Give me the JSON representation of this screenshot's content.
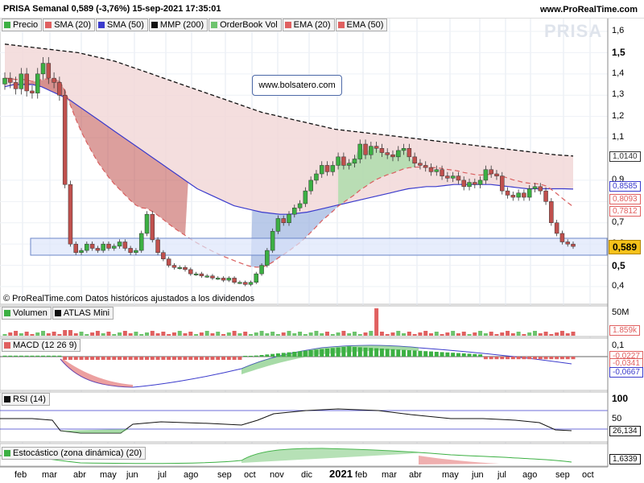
{
  "header": {
    "title": "PRISA Semanal 0,589 (-3,76%) 15-sep-2021 17:35:01",
    "site": "www.ProRealTime.com",
    "watermark": "PRISA"
  },
  "legend": [
    {
      "label": "Precio",
      "color": "#3cb043"
    },
    {
      "label": "SMA (20)",
      "color": "#e06060"
    },
    {
      "label": "SMA (50)",
      "color": "#3b3bcc"
    },
    {
      "label": "MMP (200)",
      "color": "#111111"
    },
    {
      "label": "OrderBook Vol",
      "color": "#6dc36d"
    },
    {
      "label": "EMA (20)",
      "color": "#e06060"
    },
    {
      "label": "EMA (50)",
      "color": "#e06060"
    }
  ],
  "annotation": "www.bolsatero.com",
  "footnote": "© ProRealTime.com  Datos históricos ajustados a los dividendos",
  "price_axis": {
    "ticks": [
      "1,6",
      "1,5",
      "1,4",
      "1,3",
      "1,2",
      "1,1",
      "0,9",
      "0,8",
      "0,7",
      "0,6",
      "0,5",
      "0,4"
    ],
    "tags": [
      {
        "text": "1,0140",
        "color": "#333333"
      },
      {
        "text": "0,8585",
        "color": "#3b3bcc"
      },
      {
        "text": "0,8093",
        "color": "#e06060"
      },
      {
        "text": "0,7812",
        "color": "#e06060"
      }
    ],
    "last": "0,589"
  },
  "panels": {
    "volume": {
      "labels": [
        "Volumen",
        "ATLAS Mini"
      ],
      "axis": "50M",
      "tag": "1.859k"
    },
    "macd": {
      "label": "MACD (12 26 9)",
      "axis": "0,1",
      "tags": [
        "-0,0227",
        "-0,0341",
        "-0,0667"
      ]
    },
    "rsi": {
      "label": "RSI (14)",
      "axis_top": "100",
      "axis_mid": "50",
      "tag": "26,134"
    },
    "stoch": {
      "label": "Estocástico (zona dinámica) (20)",
      "tag": "1,6339"
    }
  },
  "months": [
    "feb",
    "mar",
    "abr",
    "may",
    "jun",
    "jul",
    "ago",
    "sep",
    "oct",
    "nov",
    "dic",
    "2021",
    "feb",
    "mar",
    "abr",
    "may",
    "jun",
    "jul",
    "ago",
    "sep",
    "oct"
  ],
  "chart_data": {
    "type": "candlestick",
    "title": "PRISA Semanal 0,589 (-3,76%) 15-sep-2021 17:35:01",
    "ylim": [
      0.35,
      1.65
    ],
    "last_close": 0.589,
    "band": [
      0.54,
      0.63
    ],
    "weekly_close": [
      1.38,
      1.36,
      1.33,
      1.4,
      1.32,
      1.31,
      1.4,
      1.45,
      1.38,
      1.36,
      1.3,
      0.88,
      0.6,
      0.56,
      0.57,
      0.6,
      0.58,
      0.57,
      0.6,
      0.58,
      0.59,
      0.61,
      0.58,
      0.56,
      0.57,
      0.65,
      0.74,
      0.62,
      0.56,
      0.53,
      0.5,
      0.49,
      0.49,
      0.48,
      0.46,
      0.46,
      0.45,
      0.45,
      0.44,
      0.44,
      0.43,
      0.44,
      0.42,
      0.42,
      0.41,
      0.42,
      0.46,
      0.5,
      0.57,
      0.66,
      0.72,
      0.7,
      0.74,
      0.77,
      0.79,
      0.85,
      0.9,
      0.93,
      0.97,
      0.94,
      0.97,
      1.01,
      0.97,
      0.98,
      1.0,
      1.07,
      1.02,
      1.06,
      1.05,
      1.03,
      1.02,
      1.01,
      1.04,
      1.05,
      1.01,
      0.98,
      0.97,
      0.96,
      0.94,
      0.95,
      0.92,
      0.91,
      0.92,
      0.9,
      0.87,
      0.89,
      0.88,
      0.9,
      0.95,
      0.93,
      0.92,
      0.85,
      0.83,
      0.82,
      0.84,
      0.82,
      0.86,
      0.87,
      0.85,
      0.8,
      0.7,
      0.65,
      0.61,
      0.6,
      0.589
    ],
    "sma50": [
      1.34,
      1.35,
      1.35,
      1.35,
      1.34,
      1.32,
      1.3,
      1.28,
      1.25,
      1.22,
      1.19,
      1.16,
      1.13,
      1.1,
      1.07,
      1.04,
      1.01,
      0.98,
      0.95,
      0.92,
      0.89,
      0.86,
      0.84,
      0.82,
      0.8,
      0.78,
      0.77,
      0.76,
      0.75,
      0.745,
      0.74,
      0.74,
      0.745,
      0.75,
      0.76,
      0.77,
      0.78,
      0.79,
      0.8,
      0.81,
      0.82,
      0.83,
      0.84,
      0.85,
      0.86,
      0.865,
      0.87,
      0.87,
      0.875,
      0.88,
      0.88,
      0.88,
      0.88,
      0.88,
      0.875,
      0.87,
      0.865,
      0.86,
      0.86,
      0.86,
      0.86,
      0.86,
      0.8585
    ],
    "mmp200": [
      1.54,
      1.53,
      1.52,
      1.51,
      1.5,
      1.48,
      1.46,
      1.43,
      1.4,
      1.37,
      1.34,
      1.31,
      1.28,
      1.25,
      1.22,
      1.2,
      1.18,
      1.16,
      1.14,
      1.13,
      1.12,
      1.11,
      1.1,
      1.09,
      1.08,
      1.07,
      1.06,
      1.05,
      1.04,
      1.03,
      1.02,
      1.014
    ]
  }
}
